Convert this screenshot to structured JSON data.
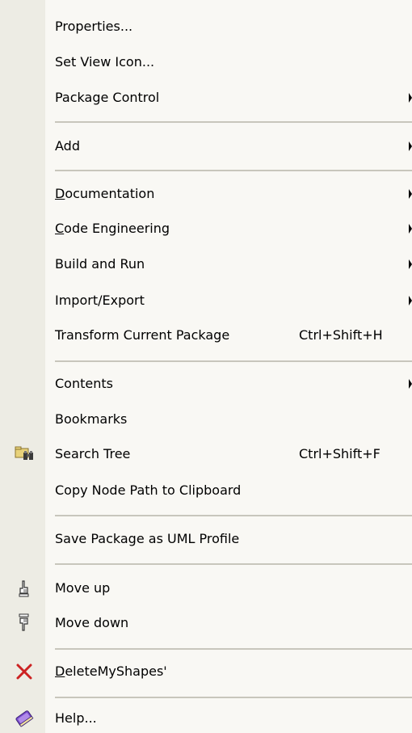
{
  "menu": {
    "properties": "Properties...",
    "set_view_icon": "Set View Icon...",
    "package_control": "Package Control",
    "add": "Add",
    "documentation": {
      "mnemonic": "D",
      "rest": "ocumentation"
    },
    "code_engineering": {
      "mnemonic": "C",
      "rest": "ode Engineering"
    },
    "build_and_run": "Build and Run",
    "import_export": "Import/Export",
    "transform_current_package": "Transform Current Package",
    "transform_shortcut": "Ctrl+Shift+H",
    "contents": "Contents",
    "bookmarks": "Bookmarks",
    "search_tree": "Search Tree",
    "search_tree_shortcut": "Ctrl+Shift+F",
    "copy_node_path": "Copy Node Path to Clipboard",
    "save_package_uml_profile": "Save Package as UML Profile",
    "move_up": "Move up",
    "move_down": "Move down",
    "delete_my_shapes": {
      "mnemonic": "D",
      "rest": "eleteMyShapes'"
    },
    "help": "Help..."
  },
  "icons": {
    "search_tree": "binoculars-folder-icon",
    "move_up": "hand-up-icon",
    "move_down": "hand-down-icon",
    "delete": "red-x-icon",
    "help": "help-book-icon"
  },
  "colors": {
    "menu_background": "#f9f8f4",
    "gutter_background": "#edece4",
    "separator": "#c8c6bc",
    "delete_icon_red": "#cc2222",
    "help_icon_purple": "#7a4ccf"
  }
}
